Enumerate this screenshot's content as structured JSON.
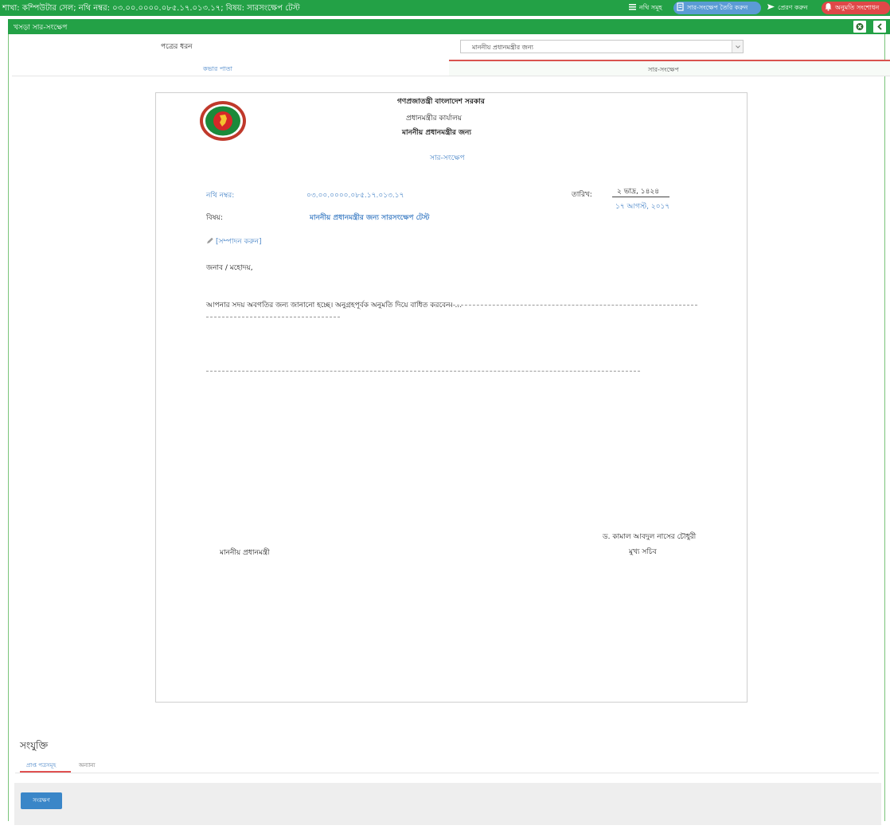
{
  "header": {
    "breadcrumb": "শাখা: কম্পিউটার সেল; নথি নম্বর: ০৩.০০.০০০০.০৮৫.১৭.০১৩.১৭; বিষয়: সারসংক্ষেপ টেস্ট",
    "buttons": {
      "notes": "নথি সমূহ",
      "create_summary": "সার-সংক্ষেপ তৈরি করুন",
      "send": "প্রেরণ করুন",
      "approve_edit": "অনুমতি সংশোধন"
    }
  },
  "titlebar": {
    "title": "খসড়া সার-সংক্ষেপ"
  },
  "form": {
    "letter_type_label": "পত্রের ধরন",
    "letter_type_value": "মাননীয় প্রধানমন্ত্রীর জন্য"
  },
  "tabs": {
    "cover": "কভার পাতা",
    "summary": "সার-সংক্ষেপ"
  },
  "document": {
    "gov_title": "গণপ্রজাতন্ত্রী বাংলাদেশ সরকার",
    "office": "প্রধানমন্ত্রীর কার্যালয়",
    "for_pm": "মাননীয় প্রধানমন্ত্রীর জন্য",
    "summary_heading": "সার-সংক্ষেপ",
    "nothi_label": "নথি নম্বর:",
    "nothi_value": "০৩.০০.০০০০.০৮৫.১৭.০১৩.১৭",
    "date_label": "তারিখ:",
    "date_bn": "২ ভাদ্র, ১৪২৪",
    "date_en": "১৭ আগস্ট, ২০১৭",
    "subject_label": "বিষয়:",
    "subject_value": "মাননীয় প্রধানমন্ত্রীর জন্য সারসংক্ষেপ টেস্ট",
    "edit_link": "[সম্পাদন করুন]",
    "salutation": "জনাব / মহোদয়,",
    "body": "আপনার সদয় অবগতির জন্য জানানো হচ্ছে। অনুগ্রহপূর্বক অনুমতি দিয়ে বাধিত করবেন। ...",
    "pm_signature": "মাননীয় প্রধানমন্ত্রী",
    "signer_name": "ড. কামাল আবদুল নাসের চৌধুরী",
    "signer_title": "মুখ্য সচিব"
  },
  "attachments": {
    "title": "সংযুক্তি",
    "tab_received": "প্রাপ্ত পত্রসমূহ",
    "tab_other": "অন্যান্য"
  },
  "footer": {
    "save_label": "সংরক্ষণ"
  },
  "colors": {
    "header_green": "#23a146",
    "link_blue": "#4a86c8",
    "approve_red": "#e04848",
    "save_blue": "#3a86c8"
  }
}
